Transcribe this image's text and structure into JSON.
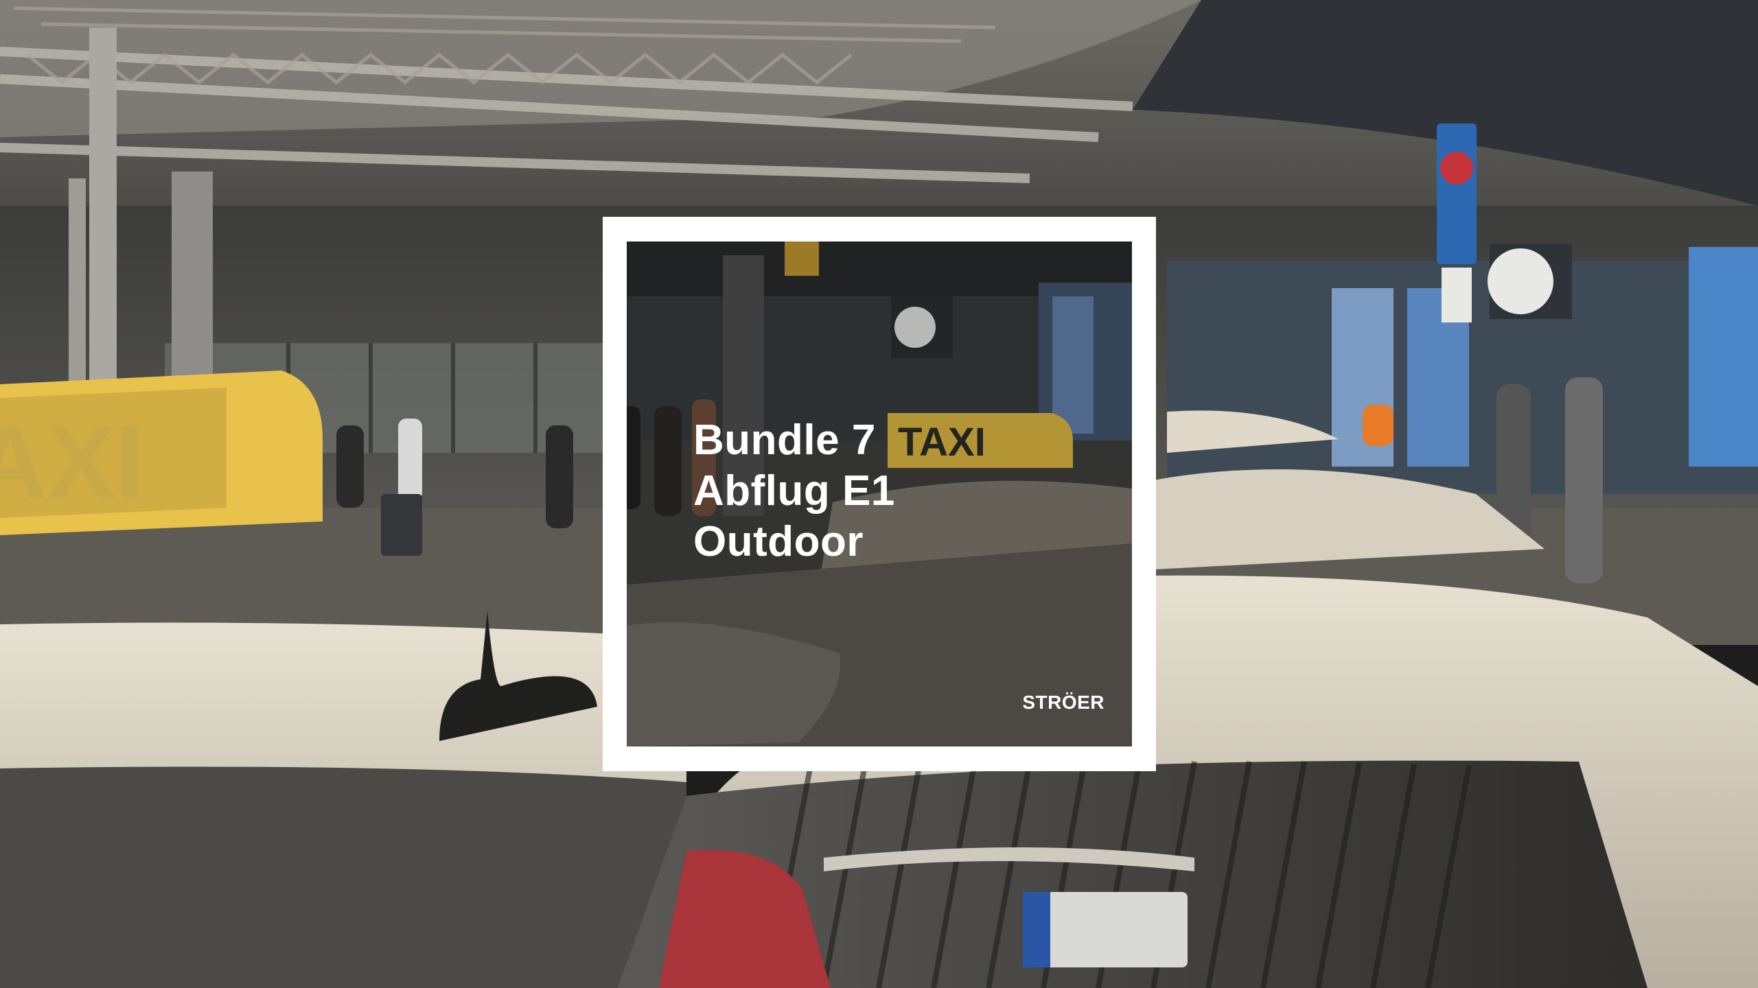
{
  "headline": {
    "line1": "Bundle 7",
    "line2": "Abflug E1",
    "line3": "Outdoor"
  },
  "background_taxi_sign_text": "AXI",
  "inner_taxi_sign_text": "TAXI",
  "logo": {
    "text": "STRÖER"
  },
  "colors": {
    "frame": "#ffffff",
    "headline": "#ffffff",
    "taxi_sign": "#e8c24a",
    "car_body": "#d9d2c2"
  }
}
